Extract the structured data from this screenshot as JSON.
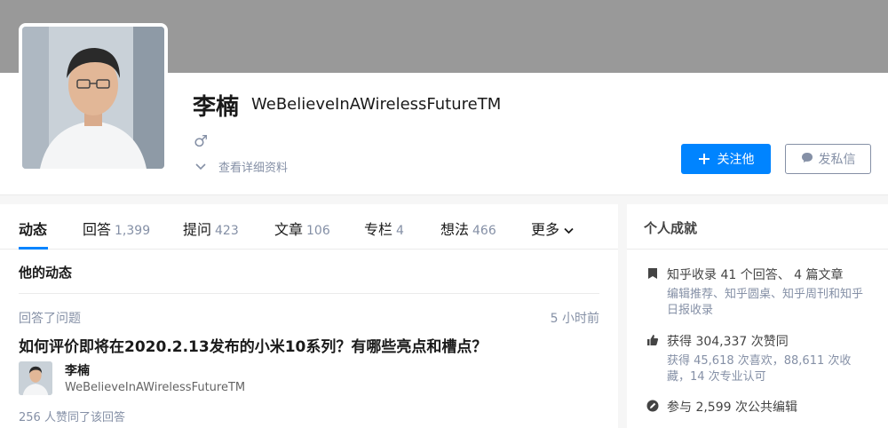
{
  "profile": {
    "name": "李楠",
    "headline": "WeBelieveInAWirelessFutureTM",
    "gender_symbol": "♂",
    "details_label": "查看详细资料",
    "follow_label": "关注他",
    "message_label": "发私信"
  },
  "tabs": [
    {
      "label": "动态",
      "count": ""
    },
    {
      "label": "回答",
      "count": "1,399"
    },
    {
      "label": "提问",
      "count": "423"
    },
    {
      "label": "文章",
      "count": "106"
    },
    {
      "label": "专栏",
      "count": "4"
    },
    {
      "label": "想法",
      "count": "466"
    },
    {
      "label": "更多",
      "count": ""
    }
  ],
  "feed": {
    "section_title": "他的动态",
    "item": {
      "action": "回答了问题",
      "time": "5 小时前",
      "question": "如何评价即将在2020.2.13发布的小米10系列？有哪些亮点和槽点？",
      "author_name": "李楠",
      "author_headline": "WeBelieveInAWirelessFutureTM",
      "votes": "256 人赞同了该回答"
    }
  },
  "achievements": {
    "title": "个人成就",
    "items": [
      {
        "icon": "bookmark-icon",
        "main": "知乎收录 41 个回答、 4 篇文章",
        "sub": "编辑推荐、知乎圆桌、知乎周刊和知乎日报收录"
      },
      {
        "icon": "thumbs-up-icon",
        "main": "获得 304,337 次赞同",
        "sub": "获得 45,618 次喜欢，88,611 次收藏，14 次专业认可"
      },
      {
        "icon": "edit-icon",
        "main": "参与 2,599 次公共编辑",
        "sub": ""
      }
    ]
  },
  "colors": {
    "accent": "#0084ff",
    "cover": "#999999",
    "muted": "#8590a6"
  }
}
